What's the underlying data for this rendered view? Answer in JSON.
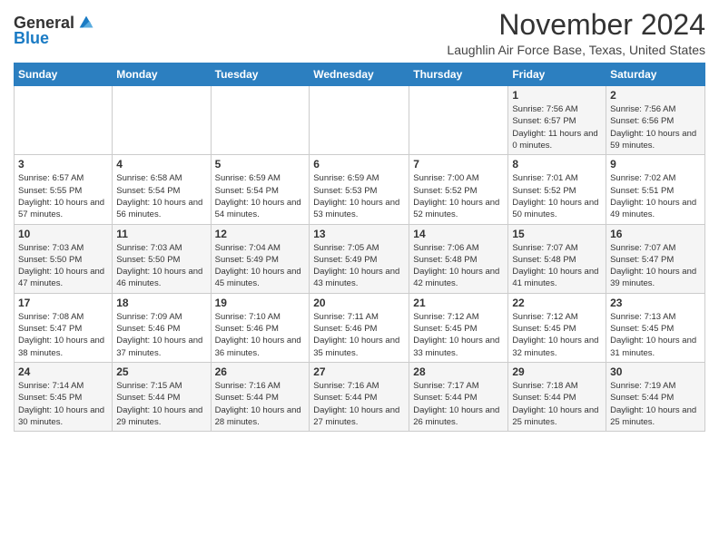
{
  "header": {
    "logo_general": "General",
    "logo_blue": "Blue",
    "month": "November 2024",
    "location": "Laughlin Air Force Base, Texas, United States"
  },
  "days_of_week": [
    "Sunday",
    "Monday",
    "Tuesday",
    "Wednesday",
    "Thursday",
    "Friday",
    "Saturday"
  ],
  "weeks": [
    [
      {
        "day": "",
        "info": ""
      },
      {
        "day": "",
        "info": ""
      },
      {
        "day": "",
        "info": ""
      },
      {
        "day": "",
        "info": ""
      },
      {
        "day": "",
        "info": ""
      },
      {
        "day": "1",
        "info": "Sunrise: 7:56 AM\nSunset: 6:57 PM\nDaylight: 11 hours and 0 minutes."
      },
      {
        "day": "2",
        "info": "Sunrise: 7:56 AM\nSunset: 6:56 PM\nDaylight: 10 hours and 59 minutes."
      }
    ],
    [
      {
        "day": "3",
        "info": "Sunrise: 6:57 AM\nSunset: 5:55 PM\nDaylight: 10 hours and 57 minutes."
      },
      {
        "day": "4",
        "info": "Sunrise: 6:58 AM\nSunset: 5:54 PM\nDaylight: 10 hours and 56 minutes."
      },
      {
        "day": "5",
        "info": "Sunrise: 6:59 AM\nSunset: 5:54 PM\nDaylight: 10 hours and 54 minutes."
      },
      {
        "day": "6",
        "info": "Sunrise: 6:59 AM\nSunset: 5:53 PM\nDaylight: 10 hours and 53 minutes."
      },
      {
        "day": "7",
        "info": "Sunrise: 7:00 AM\nSunset: 5:52 PM\nDaylight: 10 hours and 52 minutes."
      },
      {
        "day": "8",
        "info": "Sunrise: 7:01 AM\nSunset: 5:52 PM\nDaylight: 10 hours and 50 minutes."
      },
      {
        "day": "9",
        "info": "Sunrise: 7:02 AM\nSunset: 5:51 PM\nDaylight: 10 hours and 49 minutes."
      }
    ],
    [
      {
        "day": "10",
        "info": "Sunrise: 7:03 AM\nSunset: 5:50 PM\nDaylight: 10 hours and 47 minutes."
      },
      {
        "day": "11",
        "info": "Sunrise: 7:03 AM\nSunset: 5:50 PM\nDaylight: 10 hours and 46 minutes."
      },
      {
        "day": "12",
        "info": "Sunrise: 7:04 AM\nSunset: 5:49 PM\nDaylight: 10 hours and 45 minutes."
      },
      {
        "day": "13",
        "info": "Sunrise: 7:05 AM\nSunset: 5:49 PM\nDaylight: 10 hours and 43 minutes."
      },
      {
        "day": "14",
        "info": "Sunrise: 7:06 AM\nSunset: 5:48 PM\nDaylight: 10 hours and 42 minutes."
      },
      {
        "day": "15",
        "info": "Sunrise: 7:07 AM\nSunset: 5:48 PM\nDaylight: 10 hours and 41 minutes."
      },
      {
        "day": "16",
        "info": "Sunrise: 7:07 AM\nSunset: 5:47 PM\nDaylight: 10 hours and 39 minutes."
      }
    ],
    [
      {
        "day": "17",
        "info": "Sunrise: 7:08 AM\nSunset: 5:47 PM\nDaylight: 10 hours and 38 minutes."
      },
      {
        "day": "18",
        "info": "Sunrise: 7:09 AM\nSunset: 5:46 PM\nDaylight: 10 hours and 37 minutes."
      },
      {
        "day": "19",
        "info": "Sunrise: 7:10 AM\nSunset: 5:46 PM\nDaylight: 10 hours and 36 minutes."
      },
      {
        "day": "20",
        "info": "Sunrise: 7:11 AM\nSunset: 5:46 PM\nDaylight: 10 hours and 35 minutes."
      },
      {
        "day": "21",
        "info": "Sunrise: 7:12 AM\nSunset: 5:45 PM\nDaylight: 10 hours and 33 minutes."
      },
      {
        "day": "22",
        "info": "Sunrise: 7:12 AM\nSunset: 5:45 PM\nDaylight: 10 hours and 32 minutes."
      },
      {
        "day": "23",
        "info": "Sunrise: 7:13 AM\nSunset: 5:45 PM\nDaylight: 10 hours and 31 minutes."
      }
    ],
    [
      {
        "day": "24",
        "info": "Sunrise: 7:14 AM\nSunset: 5:45 PM\nDaylight: 10 hours and 30 minutes."
      },
      {
        "day": "25",
        "info": "Sunrise: 7:15 AM\nSunset: 5:44 PM\nDaylight: 10 hours and 29 minutes."
      },
      {
        "day": "26",
        "info": "Sunrise: 7:16 AM\nSunset: 5:44 PM\nDaylight: 10 hours and 28 minutes."
      },
      {
        "day": "27",
        "info": "Sunrise: 7:16 AM\nSunset: 5:44 PM\nDaylight: 10 hours and 27 minutes."
      },
      {
        "day": "28",
        "info": "Sunrise: 7:17 AM\nSunset: 5:44 PM\nDaylight: 10 hours and 26 minutes."
      },
      {
        "day": "29",
        "info": "Sunrise: 7:18 AM\nSunset: 5:44 PM\nDaylight: 10 hours and 25 minutes."
      },
      {
        "day": "30",
        "info": "Sunrise: 7:19 AM\nSunset: 5:44 PM\nDaylight: 10 hours and 25 minutes."
      }
    ]
  ]
}
